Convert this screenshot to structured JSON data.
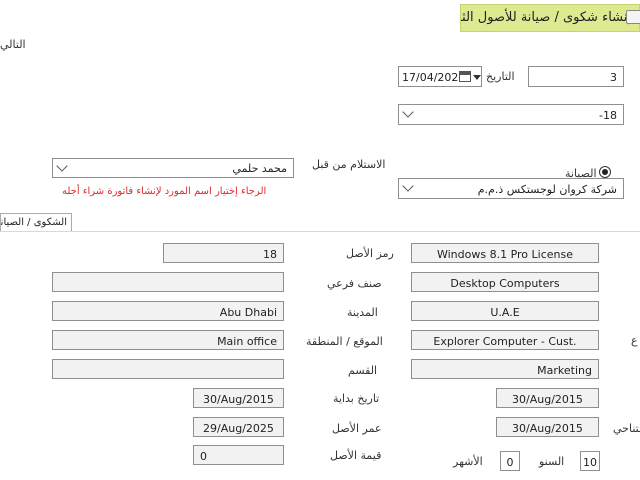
{
  "window": {
    "title": "إنشاء شكوى / صيانة للأصول الثابتة",
    "next_label": "التالي"
  },
  "header": {
    "number_value": "3",
    "date_label": "التاريخ",
    "date_value": "17/04/2022",
    "branch_value": "18-",
    "maintenance_label": "الصيانة",
    "vendor_value": "شركة كروان لوجستكس ذ.م.م",
    "received_by_label": "الاستلام من قبل",
    "received_by_value": "محمد حلمي",
    "error_message": "الرجاء إختيار اسم المورد لإنشاء فاتورة شراء أجله"
  },
  "tab": {
    "label": "الشكوى / الصيانة"
  },
  "details": {
    "asset_name": "Windows 8.1 Pro License",
    "asset_code_label": "رمز الأصل",
    "asset_code": "18",
    "category": "Desktop Computers",
    "subcategory_label": "صنف فرعي",
    "subcategory": "",
    "country": "U.A.E",
    "city_label": "المدينة",
    "city": "Abu Dhabi",
    "customer": "Explorer Computer - Cust.",
    "location_label": "الموقع / المنطقة",
    "location": "Main office",
    "trailing_label_a": "ع",
    "department_value": "Marketing",
    "section_label": "القسم",
    "section": "",
    "purchase_date": "30/Aug/2015",
    "start_date_label": "تاريخ بداية",
    "start_date": "30/Aug/2015",
    "expiry_date": "30/Aug/2015",
    "asset_age_label": "عمر الأصل",
    "asset_age": "29/Aug/2025",
    "trailing_label_b": "متناحي",
    "years_value": "10",
    "years_label": "السنو",
    "months_value": "0",
    "months_label": "الأشهر",
    "asset_value_label": "قيمة الأصل",
    "asset_value": "0"
  }
}
